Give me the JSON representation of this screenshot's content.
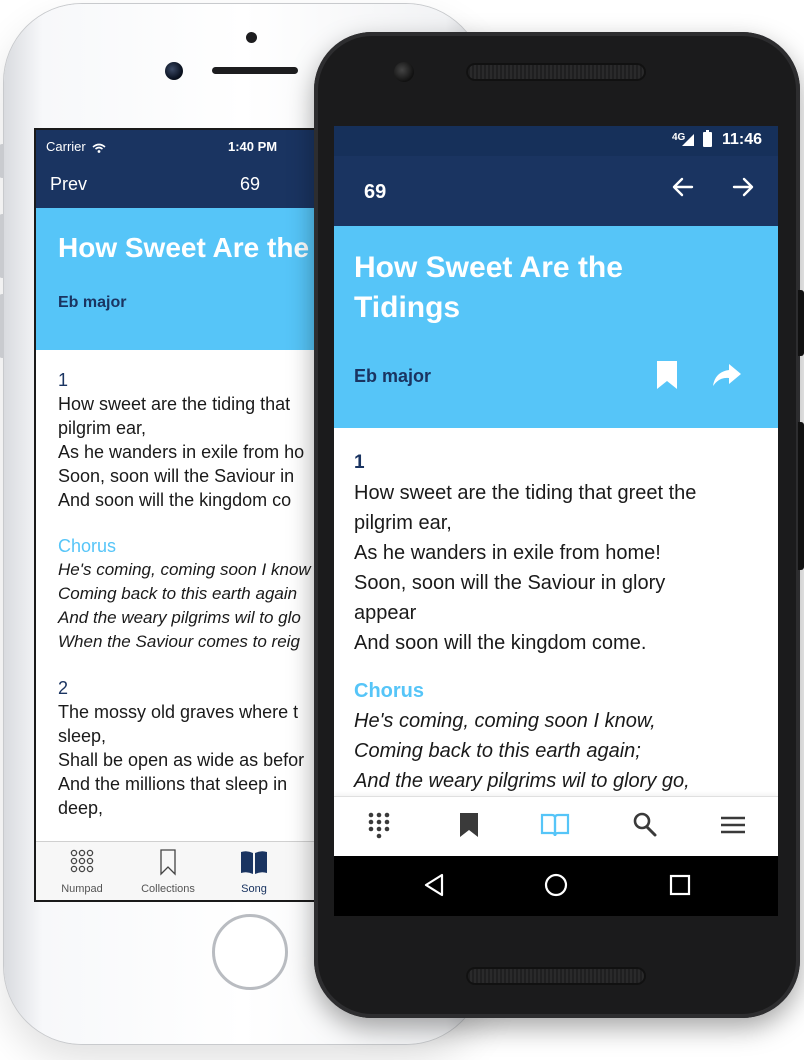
{
  "ios": {
    "status": {
      "carrier": "Carrier",
      "time": "1:40 PM"
    },
    "nav": {
      "prev_label": "Prev",
      "hymn_number": "69"
    },
    "song": {
      "title": "How Sweet Are the",
      "key": "Eb major",
      "verse1_number": "1",
      "verse1_lines": [
        "How sweet are the tiding that",
        "pilgrim ear,",
        "As he wanders in exile from ho",
        "Soon, soon will the Saviour in",
        "And soon will the kingdom co"
      ],
      "chorus_label": "Chorus",
      "chorus_lines": [
        "He's coming, coming soon I know",
        "Coming back to this earth again",
        "And the weary pilgrims wil to glo",
        "When the Saviour comes to reig"
      ],
      "verse2_number": "2",
      "verse2_lines": [
        "The mossy old graves where t",
        "sleep,",
        "Shall be open as wide as befor",
        "And the millions that sleep in",
        "deep,"
      ]
    },
    "tabs": [
      {
        "label": "Numpad",
        "icon": "numpad-icon"
      },
      {
        "label": "Collections",
        "icon": "bookmark-outline-icon"
      },
      {
        "label": "Song",
        "icon": "book-icon"
      }
    ]
  },
  "android": {
    "status": {
      "network": "4G",
      "time": "11:46"
    },
    "toolbar": {
      "hymn_number": "69",
      "back_icon": "arrow-left-icon",
      "forward_icon": "arrow-right-icon"
    },
    "song": {
      "title": "How Sweet Are the Tidings",
      "key": "Eb major",
      "verse1_number": "1",
      "verse1_lines": [
        "How sweet are the tiding that greet the",
        "pilgrim ear,",
        "As he wanders in exile from home!",
        "Soon, soon will the Saviour in glory",
        "appear",
        "And soon will the kingdom come."
      ],
      "chorus_label": "Chorus",
      "chorus_lines": [
        "He's coming, coming soon I know,",
        "Coming back to this earth again;",
        "And the weary pilgrims wil to glory go,"
      ]
    },
    "bottom_nav": [
      "numpad-icon",
      "bookmark-icon",
      "book-icon",
      "search-icon",
      "menu-icon"
    ],
    "accent_color": "#56c5f8",
    "primary_color": "#1a3461"
  }
}
